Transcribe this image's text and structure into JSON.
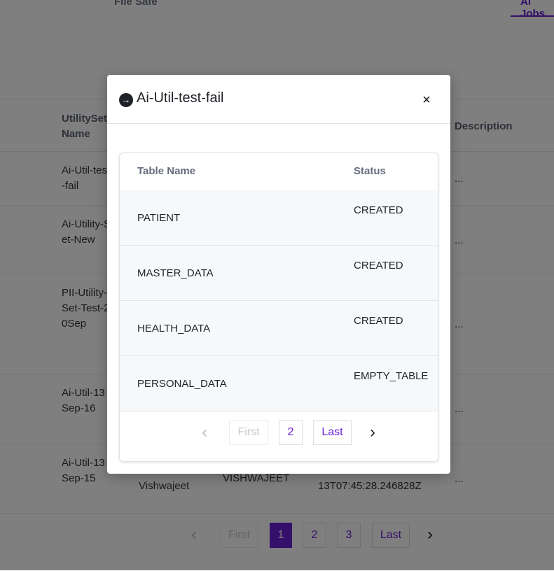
{
  "background": {
    "tabs": {
      "file_safe": "File Safe",
      "ai_jobs": "Ai Jobs"
    },
    "table_headers": {
      "utility_set_name": "UtilitySet Name",
      "description": "Description"
    },
    "rows": [
      {
        "util": "Ai-Util-test-fail",
        "desc": "..."
      },
      {
        "util": "Ai-Utility-Set-New",
        "desc": "..."
      },
      {
        "util": "PII-Utility-Set-Test-20Sep",
        "desc": "..."
      },
      {
        "util": "Ai-Util-13Sep-16",
        "desc": "..."
      },
      {
        "util": "Ai-Util-13Sep-15",
        "desc": "...",
        "user": "Vishwajeet",
        "user_upper": "VISHWAJEET",
        "timestamp": "13T07:45:28.246828Z"
      }
    ],
    "pagination": {
      "prev_icon": "chevron-left-icon",
      "first": "First",
      "pages": [
        "1",
        "2",
        "3"
      ],
      "active_page": "1",
      "last": "Last",
      "next_icon": "chevron-right-icon"
    }
  },
  "modal": {
    "title": "Ai-Util-test-fail",
    "title_icon": "arrow-circle-right-icon",
    "close_label": "×",
    "headers": {
      "table_name": "Table Name",
      "status": "Status"
    },
    "rows": [
      {
        "table_name": "PATIENT",
        "status": "CREATED"
      },
      {
        "table_name": "MASTER_DATA",
        "status": "CREATED"
      },
      {
        "table_name": "HEALTH_DATA",
        "status": "CREATED"
      },
      {
        "table_name": "PERSONAL_DATA",
        "status": "EMPTY_TABLE"
      }
    ],
    "pagination": {
      "prev_icon": "chevron-left-icon",
      "first": "First",
      "page": "2",
      "last": "Last",
      "next_icon": "chevron-right-icon"
    }
  },
  "colors": {
    "accent": "#6b21d6",
    "overlay": "rgba(0,0,0,0.5)"
  }
}
